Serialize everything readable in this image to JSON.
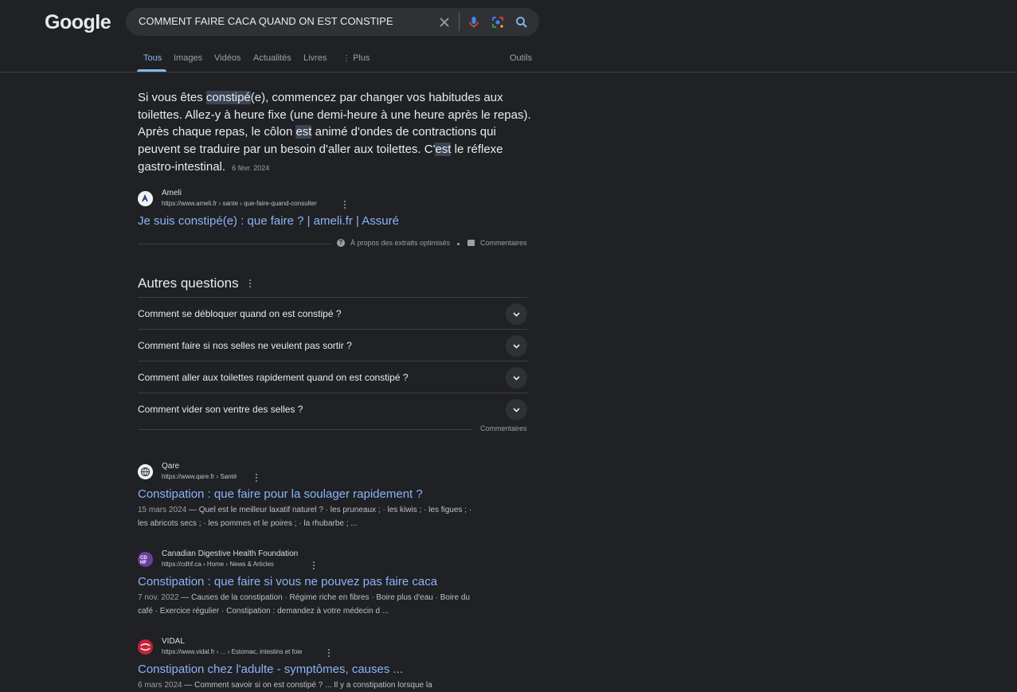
{
  "header": {
    "logo": "Google",
    "query": "COMMENT FAIRE CACA QUAND ON EST CONSTIPE"
  },
  "tabs": [
    {
      "label": "Tous",
      "active": true
    },
    {
      "label": "Images"
    },
    {
      "label": "Vidéos"
    },
    {
      "label": "Actualités"
    },
    {
      "label": "Livres"
    },
    {
      "label": "Plus"
    }
  ],
  "tools_label": "Outils",
  "snippet": {
    "p1": "Si vous êtes ",
    "h1": "constipé",
    "p2": "(e), commencez par changer vos habitudes aux toilettes. Allez-y à heure fixe (une demi-heure à une heure après le repas). Après chaque repas, le côlon ",
    "h2": "est",
    "p3": " animé d'ondes de contractions qui peuvent se traduire par un besoin d'aller aux toilettes. C'",
    "h3": "est",
    "p4": " le réflexe gastro-intestinal.",
    "date": "6 févr. 2024",
    "source_name": "Ameli",
    "source_url": "https://www.ameli.fr › sante › que-faire-quand-consulter",
    "link_title": "Je suis constipé(e) : que faire ? | ameli.fr | Assuré",
    "about_label": "À propos des extraits optimisés",
    "feedback_label": "Commentaires"
  },
  "paa": {
    "title": "Autres questions",
    "questions": [
      "Comment se débloquer quand on est constipé ?",
      "Comment faire si nos selles ne veulent pas sortir ?",
      "Comment aller aux toilettes rapidement quand on est constipé ?",
      "Comment vider son ventre des selles ?"
    ],
    "feedback_label": "Commentaires"
  },
  "results": [
    {
      "site": "Qare",
      "url": "https://www.qare.fr › Santé",
      "title": "Constipation : que faire pour la soulager rapidement ?",
      "date": "15 mars 2024",
      "sep": " — ",
      "line1": "Quel est le meilleur laxatif naturel ? · les pruneaux ; · les kiwis ; · les figues ; ·",
      "line2": "les abricots secs ; · les pommes et le poires ; · la rhubarbe ; ..."
    },
    {
      "site": "Canadian Digestive Health Foundation",
      "url": "https://cdhf.ca › Home › News & Articles",
      "title": "Constipation : que faire si vous ne pouvez pas faire caca",
      "date": "7 nov. 2022",
      "sep": " — ",
      "line1": "Causes de la constipation · Régime riche en fibres · Boire plus d'eau · Boire du",
      "line2": "café · Exercice régulier · Constipation : demandez à votre médecin d ..."
    },
    {
      "site": "VIDAL",
      "url": "https://www.vidal.fr › ... › Estomac, intestins et foie",
      "title": "Constipation chez l'adulte - symptômes, causes ...",
      "date": "6 mars 2024",
      "sep": " — ",
      "line1": "Comment savoir si on est constipé ? ... Il y a constipation lorsque la"
    }
  ]
}
